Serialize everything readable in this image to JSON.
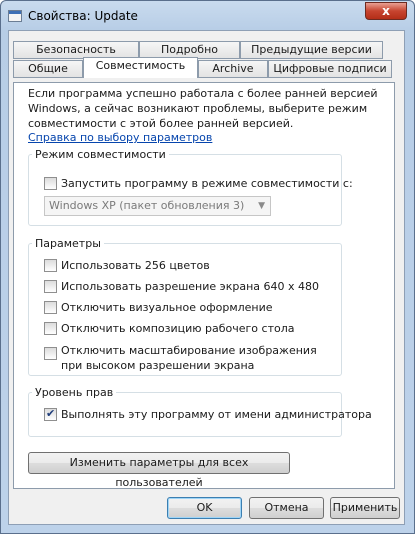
{
  "window": {
    "title": "Свойства: Update",
    "close_label": "x"
  },
  "tabs_row1": [
    {
      "label": "Безопасность"
    },
    {
      "label": "Подробно"
    },
    {
      "label": "Предыдущие версии"
    }
  ],
  "tabs_row2": [
    {
      "label": "Общие"
    },
    {
      "label": "Совместимость",
      "active": true
    },
    {
      "label": "Archive"
    },
    {
      "label": "Цифровые подписи"
    }
  ],
  "compat": {
    "intro": "Если программа успешно работала с более ранней версией Windows, а сейчас возникают проблемы, выберите режим совместимости с этой более ранней версией.",
    "help_link": "Справка по выбору параметров",
    "mode_group": {
      "title": "Режим совместимости",
      "checkbox_label": "Запустить программу в режиме совместимости с:",
      "checked": false,
      "dropdown_value": "Windows XP (пакет обновления 3)"
    },
    "params_group": {
      "title": "Параметры",
      "items": [
        {
          "label": "Использовать 256 цветов",
          "checked": false
        },
        {
          "label": "Использовать разрешение экрана 640 x 480",
          "checked": false
        },
        {
          "label": "Отключить визуальное оформление",
          "checked": false
        },
        {
          "label": "Отключить композицию рабочего стола",
          "checked": false
        },
        {
          "label": "Отключить масштабирование изображения при высоком разрешении экрана",
          "checked": false
        }
      ]
    },
    "privilege_group": {
      "title": "Уровень прав",
      "checkbox_label": "Выполнять эту программу от имени администратора",
      "checked": true
    },
    "all_users_button": "Изменить параметры для всех пользователей"
  },
  "footer": {
    "ok": "OK",
    "cancel": "Отмена",
    "apply": "Применить"
  }
}
